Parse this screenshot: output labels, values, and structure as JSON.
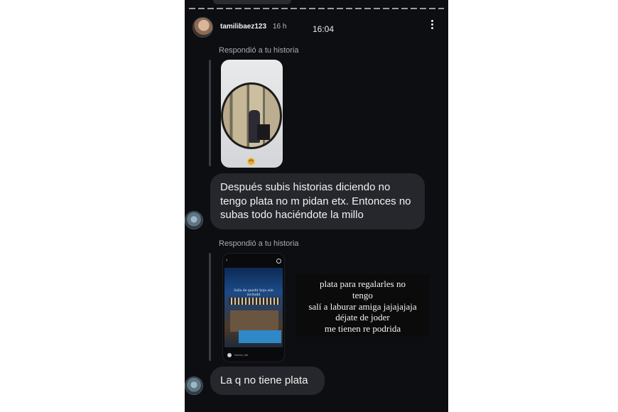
{
  "header": {
    "username": "tamilibaez123",
    "time_ago": "16 h",
    "clock": "16:04",
    "more_icon": "more-vertical-icon"
  },
  "messages": [
    {
      "replied_label": "Respondió a tu historia",
      "story": {
        "reaction": "😳"
      },
      "text": "Después subis historias diciendo no tengo plata no m pidan etx. Entonces no subas todo haciéndote la millo"
    },
    {
      "replied_label": "Respondió a tu historia",
      "story": {
        "caption": "Salía de quedir hoja aún invitadd",
        "footer": "hammo_oidi"
      },
      "overlay_text": "plata para regalarles no\ntengo\nsalí a laburar amiga jajajajaja\ndéjate de joder\nme tienen re podrida"
    },
    {
      "text": "La q no tiene plata"
    }
  ],
  "colors": {
    "background": "#0d0e12",
    "bubble": "#26272c",
    "text": "#f2f2f2",
    "muted": "#a9abb2"
  }
}
